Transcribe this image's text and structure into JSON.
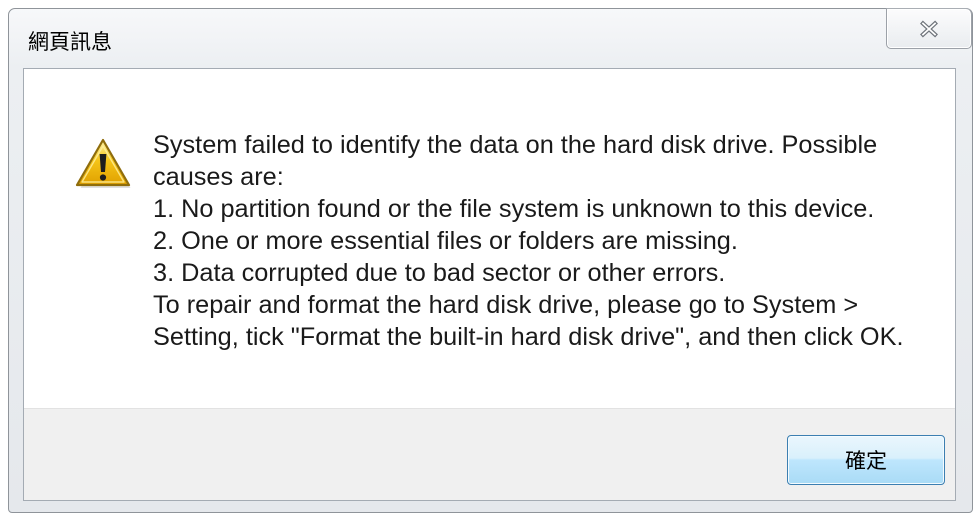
{
  "window": {
    "title": "網頁訊息",
    "close_icon": "close-icon"
  },
  "message": {
    "icon": "warning-icon",
    "lines": [
      "System failed to identify the data on the hard disk drive. Possible",
      "causes are:",
      "1. No partition found or the file system is unknown to this device.",
      "2. One or more essential files or folders are missing.",
      "3. Data corrupted due to bad sector or other errors.",
      "To repair and format the hard disk drive, please go to System >",
      "Setting, tick \"Format the built-in hard disk drive\", and then click OK."
    ]
  },
  "buttons": {
    "ok_label": "確定"
  },
  "colors": {
    "warning_yellow": "#f5c518",
    "default_button_border": "#3c7fb1"
  }
}
